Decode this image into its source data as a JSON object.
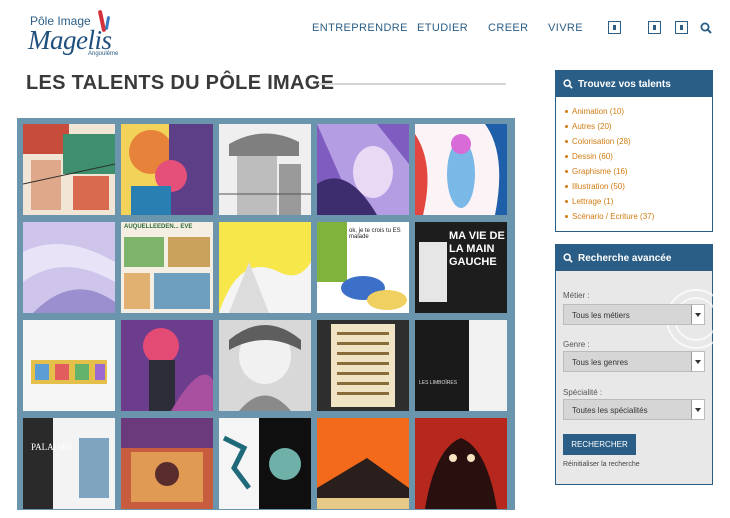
{
  "logo": {
    "small": "Pôle Image",
    "big": "Magelis",
    "city": "Angoulême"
  },
  "nav": [
    "ENTREPRENDRE",
    "ETUDIER",
    "CREER",
    "VIVRE"
  ],
  "page_title": "LES TALENTS DU PÔLE IMAGE",
  "talents_box": {
    "title": "Trouvez vos talents",
    "items": [
      "Animation (10)",
      "Autres (20)",
      "Colorisation (28)",
      "Dessin (60)",
      "Graphisme (16)",
      "Illustration (50)",
      "Lettrage (1)",
      "Scénario / Ecriture (37)"
    ]
  },
  "advanced_search": {
    "title": "Recherche avancée",
    "metier_label": "Métier :",
    "metier_value": "Tous les métiers",
    "genre_label": "Genre :",
    "genre_value": "Tous les genres",
    "specialite_label": "Spécialité :",
    "specialite_value": "Toutes les spécialités",
    "submit": "RECHERCHER",
    "reset": "Réinitialiser la recherche"
  },
  "thumb_texts": {
    "t7": "AUQUELLEEDEN... EVE",
    "t9": "ok, je te crois tu ES malade",
    "t10": "MA VIE DE LA MAIN GAUCHE",
    "t16": "PALAISES",
    "t14": "LES LIMBOÏRES"
  },
  "colors": {
    "accent": "#2b5e86",
    "talent_link": "#d07c12",
    "gallery_bg": "#6a95ad"
  }
}
